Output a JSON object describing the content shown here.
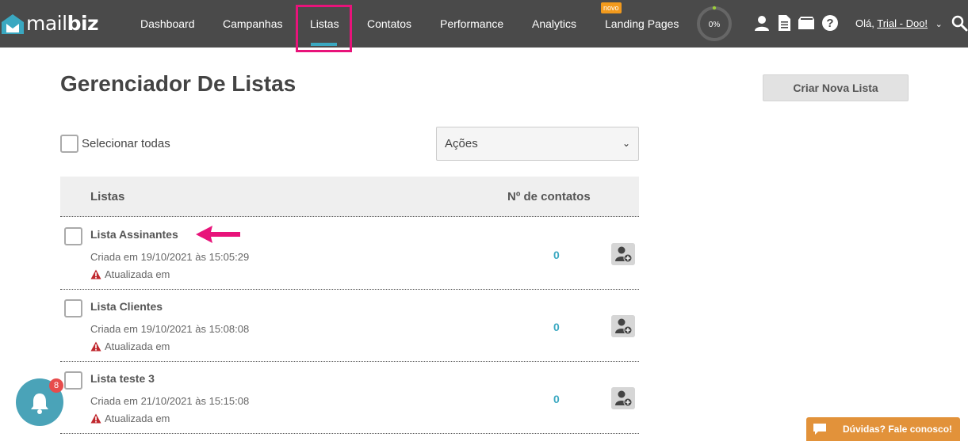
{
  "app": {
    "logo_text": "mailbiz",
    "brand_color": "#3aa8c1",
    "highlight_color": "#e8137a"
  },
  "nav": {
    "items": [
      {
        "label": "Dashboard"
      },
      {
        "label": "Campanhas"
      },
      {
        "label": "Listas",
        "active": true
      },
      {
        "label": "Contatos"
      },
      {
        "label": "Performance"
      },
      {
        "label": "Analytics"
      },
      {
        "label": "Landing Pages",
        "badge": "novo"
      }
    ],
    "progress_label": "0%",
    "progress_value": 0,
    "icons": [
      "user-icon",
      "document-icon",
      "folder-icon",
      "help-icon",
      "search-icon"
    ],
    "greeting": "Olá,",
    "user_name": "Trial - Doo!"
  },
  "page": {
    "title": "Gerenciador De Listas",
    "create_button": "Criar Nova Lista",
    "select_all_label": "Selecionar todas",
    "actions_select": "Ações"
  },
  "table": {
    "columns": [
      "Listas",
      "Nº de contatos"
    ],
    "rows": [
      {
        "name": "Lista Assinantes",
        "created": "Criada em 19/10/2021 às 15:05:29",
        "updated": "Atualizada em",
        "count": "0"
      },
      {
        "name": "Lista Clientes",
        "created": "Criada em 19/10/2021 às 15:08:08",
        "updated": "Atualizada em",
        "count": "0"
      },
      {
        "name": "Lista teste 3",
        "created": "Criada em 21/10/2021 às 15:15:08",
        "updated": "Atualizada em",
        "count": "0"
      }
    ]
  },
  "notifications": {
    "count": "8"
  },
  "help": {
    "label": "Dúvidas? Fale conosco!"
  }
}
